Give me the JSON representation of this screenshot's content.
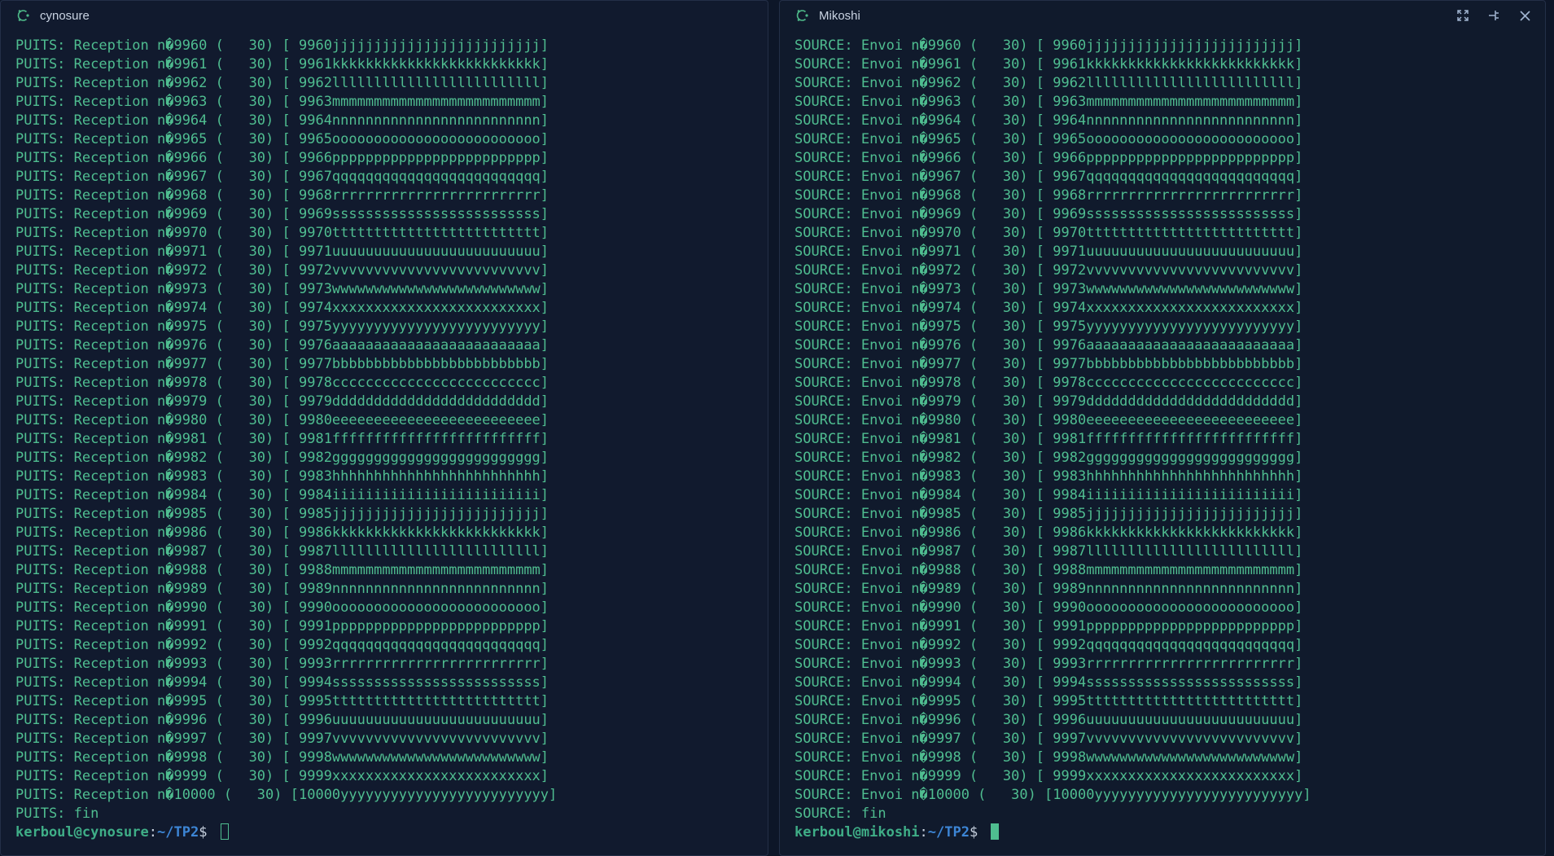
{
  "left": {
    "title": "cynosure",
    "prefix": "PUITS: Reception n�",
    "final_line": "PUITS: fin",
    "prompt": {
      "user_host": "kerboul@cynosure",
      "sep": ":",
      "path": "~/TP2",
      "symbol": "$ "
    }
  },
  "right": {
    "title": "Mikoshi",
    "prefix": "SOURCE: Envoi n�",
    "final_line": "SOURCE: fin",
    "prompt": {
      "user_host": "kerboul@mikoshi",
      "sep": ":",
      "path": "~/TP2",
      "symbol": "$ "
    }
  },
  "records": [
    {
      "n": "9960",
      "size": "30",
      "payload": "9960jjjjjjjjjjjjjjjjjjjjjjjjj"
    },
    {
      "n": "9961",
      "size": "30",
      "payload": "9961kkkkkkkkkkkkkkkkkkkkkkkkk"
    },
    {
      "n": "9962",
      "size": "30",
      "payload": "9962lllllllllllllllllllllllll"
    },
    {
      "n": "9963",
      "size": "30",
      "payload": "9963mmmmmmmmmmmmmmmmmmmmmmmmm"
    },
    {
      "n": "9964",
      "size": "30",
      "payload": "9964nnnnnnnnnnnnnnnnnnnnnnnnn"
    },
    {
      "n": "9965",
      "size": "30",
      "payload": "9965ooooooooooooooooooooooooo"
    },
    {
      "n": "9966",
      "size": "30",
      "payload": "9966ppppppppppppppppppppppppp"
    },
    {
      "n": "9967",
      "size": "30",
      "payload": "9967qqqqqqqqqqqqqqqqqqqqqqqqq"
    },
    {
      "n": "9968",
      "size": "30",
      "payload": "9968rrrrrrrrrrrrrrrrrrrrrrrrr"
    },
    {
      "n": "9969",
      "size": "30",
      "payload": "9969sssssssssssssssssssssssss"
    },
    {
      "n": "9970",
      "size": "30",
      "payload": "9970ttttttttttttttttttttttttt"
    },
    {
      "n": "9971",
      "size": "30",
      "payload": "9971uuuuuuuuuuuuuuuuuuuuuuuuu"
    },
    {
      "n": "9972",
      "size": "30",
      "payload": "9972vvvvvvvvvvvvvvvvvvvvvvvvv"
    },
    {
      "n": "9973",
      "size": "30",
      "payload": "9973wwwwwwwwwwwwwwwwwwwwwwwww"
    },
    {
      "n": "9974",
      "size": "30",
      "payload": "9974xxxxxxxxxxxxxxxxxxxxxxxxx"
    },
    {
      "n": "9975",
      "size": "30",
      "payload": "9975yyyyyyyyyyyyyyyyyyyyyyyyy"
    },
    {
      "n": "9976",
      "size": "30",
      "payload": "9976aaaaaaaaaaaaaaaaaaaaaaaaa"
    },
    {
      "n": "9977",
      "size": "30",
      "payload": "9977bbbbbbbbbbbbbbbbbbbbbbbbb"
    },
    {
      "n": "9978",
      "size": "30",
      "payload": "9978ccccccccccccccccccccccccc"
    },
    {
      "n": "9979",
      "size": "30",
      "payload": "9979ddddddddddddddddddddddddd"
    },
    {
      "n": "9980",
      "size": "30",
      "payload": "9980eeeeeeeeeeeeeeeeeeeeeeeee"
    },
    {
      "n": "9981",
      "size": "30",
      "payload": "9981fffffffffffffffffffffffff"
    },
    {
      "n": "9982",
      "size": "30",
      "payload": "9982ggggggggggggggggggggggggg"
    },
    {
      "n": "9983",
      "size": "30",
      "payload": "9983hhhhhhhhhhhhhhhhhhhhhhhhh"
    },
    {
      "n": "9984",
      "size": "30",
      "payload": "9984iiiiiiiiiiiiiiiiiiiiiiiii"
    },
    {
      "n": "9985",
      "size": "30",
      "payload": "9985jjjjjjjjjjjjjjjjjjjjjjjjj"
    },
    {
      "n": "9986",
      "size": "30",
      "payload": "9986kkkkkkkkkkkkkkkkkkkkkkkkk"
    },
    {
      "n": "9987",
      "size": "30",
      "payload": "9987lllllllllllllllllllllllll"
    },
    {
      "n": "9988",
      "size": "30",
      "payload": "9988mmmmmmmmmmmmmmmmmmmmmmmmm"
    },
    {
      "n": "9989",
      "size": "30",
      "payload": "9989nnnnnnnnnnnnnnnnnnnnnnnnn"
    },
    {
      "n": "9990",
      "size": "30",
      "payload": "9990ooooooooooooooooooooooooo"
    },
    {
      "n": "9991",
      "size": "30",
      "payload": "9991ppppppppppppppppppppppppp"
    },
    {
      "n": "9992",
      "size": "30",
      "payload": "9992qqqqqqqqqqqqqqqqqqqqqqqqq"
    },
    {
      "n": "9993",
      "size": "30",
      "payload": "9993rrrrrrrrrrrrrrrrrrrrrrrrr"
    },
    {
      "n": "9994",
      "size": "30",
      "payload": "9994sssssssssssssssssssssssss"
    },
    {
      "n": "9995",
      "size": "30",
      "payload": "9995ttttttttttttttttttttttttt"
    },
    {
      "n": "9996",
      "size": "30",
      "payload": "9996uuuuuuuuuuuuuuuuuuuuuuuuu"
    },
    {
      "n": "9997",
      "size": "30",
      "payload": "9997vvvvvvvvvvvvvvvvvvvvvvvvv"
    },
    {
      "n": "9998",
      "size": "30",
      "payload": "9998wwwwwwwwwwwwwwwwwwwwwwwww"
    },
    {
      "n": "9999",
      "size": "30",
      "payload": "9999xxxxxxxxxxxxxxxxxxxxxxxxx"
    },
    {
      "n": "10000",
      "size": "30",
      "payload": "10000yyyyyyyyyyyyyyyyyyyyyyyyy"
    }
  ]
}
